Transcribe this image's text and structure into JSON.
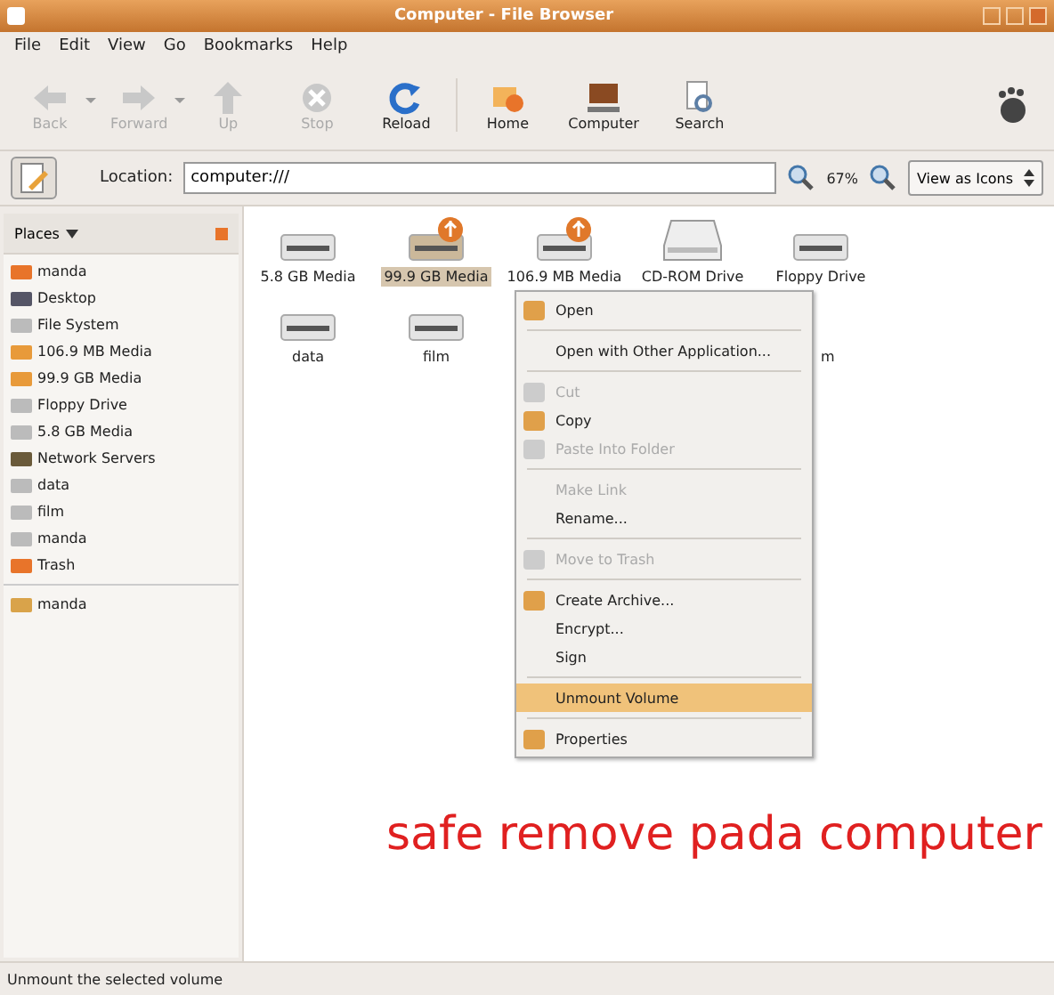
{
  "window": {
    "title": "Computer - File Browser"
  },
  "menubar": [
    "File",
    "Edit",
    "View",
    "Go",
    "Bookmarks",
    "Help"
  ],
  "toolbar": [
    {
      "label": "Back",
      "kind": "back",
      "disabled": true,
      "dropdown": true
    },
    {
      "label": "Forward",
      "kind": "forward",
      "disabled": true,
      "dropdown": true
    },
    {
      "label": "Up",
      "kind": "up",
      "disabled": true,
      "dropdown": false
    },
    {
      "label": "Stop",
      "kind": "stop",
      "disabled": true,
      "dropdown": false
    },
    {
      "label": "Reload",
      "kind": "reload",
      "disabled": false,
      "dropdown": false
    },
    {
      "label": "Home",
      "kind": "home",
      "disabled": false,
      "dropdown": false
    },
    {
      "label": "Computer",
      "kind": "computer",
      "disabled": false,
      "dropdown": false
    },
    {
      "label": "Search",
      "kind": "search",
      "disabled": false,
      "dropdown": false
    }
  ],
  "location": {
    "label": "Location:",
    "value": "computer:///",
    "zoom": "67%",
    "view": "View as Icons"
  },
  "sidebar": {
    "title": "Places",
    "places": [
      {
        "label": "manda",
        "kind": "home"
      },
      {
        "label": "Desktop",
        "kind": "desktop"
      },
      {
        "label": "File System",
        "kind": "drive"
      },
      {
        "label": "106.9 MB Media",
        "kind": "media"
      },
      {
        "label": "99.9 GB Media",
        "kind": "media"
      },
      {
        "label": "Floppy Drive",
        "kind": "drive"
      },
      {
        "label": "5.8 GB Media",
        "kind": "drive"
      },
      {
        "label": "Network Servers",
        "kind": "network"
      },
      {
        "label": "data",
        "kind": "drive"
      },
      {
        "label": "film",
        "kind": "drive"
      },
      {
        "label": "manda",
        "kind": "drive"
      },
      {
        "label": "Trash",
        "kind": "trash"
      }
    ],
    "bookmarks": [
      {
        "label": "manda",
        "kind": "folder"
      }
    ]
  },
  "icons": [
    {
      "label": "5.8 GB Media",
      "kind": "drive",
      "selected": false
    },
    {
      "label": "99.9 GB Media",
      "kind": "media",
      "selected": true
    },
    {
      "label": "106.9 MB Media",
      "kind": "media",
      "selected": false
    },
    {
      "label": "CD-ROM Drive",
      "kind": "cdrom",
      "selected": false
    },
    {
      "label": "Floppy Drive",
      "kind": "drive",
      "selected": false
    },
    {
      "label": "data",
      "kind": "drive",
      "selected": false
    },
    {
      "label": "film",
      "kind": "drive",
      "selected": false
    },
    {
      "label": "m",
      "kind": "hidden",
      "selected": false
    }
  ],
  "context_menu": [
    {
      "kind": "item",
      "label": "Open",
      "icon": true,
      "disabled": false,
      "selected": false
    },
    {
      "kind": "separator"
    },
    {
      "kind": "item",
      "label": "Open with Other Application...",
      "icon": false,
      "disabled": false,
      "selected": false
    },
    {
      "kind": "separator"
    },
    {
      "kind": "item",
      "label": "Cut",
      "icon": true,
      "disabled": true,
      "selected": false
    },
    {
      "kind": "item",
      "label": "Copy",
      "icon": true,
      "disabled": false,
      "selected": false
    },
    {
      "kind": "item",
      "label": "Paste Into Folder",
      "icon": true,
      "disabled": true,
      "selected": false
    },
    {
      "kind": "separator"
    },
    {
      "kind": "item",
      "label": "Make Link",
      "icon": false,
      "disabled": true,
      "selected": false
    },
    {
      "kind": "item",
      "label": "Rename...",
      "icon": false,
      "disabled": false,
      "selected": false
    },
    {
      "kind": "separator"
    },
    {
      "kind": "item",
      "label": "Move to Trash",
      "icon": true,
      "disabled": true,
      "selected": false
    },
    {
      "kind": "separator"
    },
    {
      "kind": "item",
      "label": "Create Archive...",
      "icon": true,
      "disabled": false,
      "selected": false
    },
    {
      "kind": "item",
      "label": "Encrypt...",
      "icon": false,
      "disabled": false,
      "selected": false
    },
    {
      "kind": "item",
      "label": "Sign",
      "icon": false,
      "disabled": false,
      "selected": false
    },
    {
      "kind": "separator"
    },
    {
      "kind": "item",
      "label": "Unmount Volume",
      "icon": false,
      "disabled": false,
      "selected": true
    },
    {
      "kind": "separator"
    },
    {
      "kind": "item",
      "label": "Properties",
      "icon": true,
      "disabled": false,
      "selected": false
    }
  ],
  "annotation": "safe remove pada computer",
  "status_bar": "Unmount the selected volume"
}
